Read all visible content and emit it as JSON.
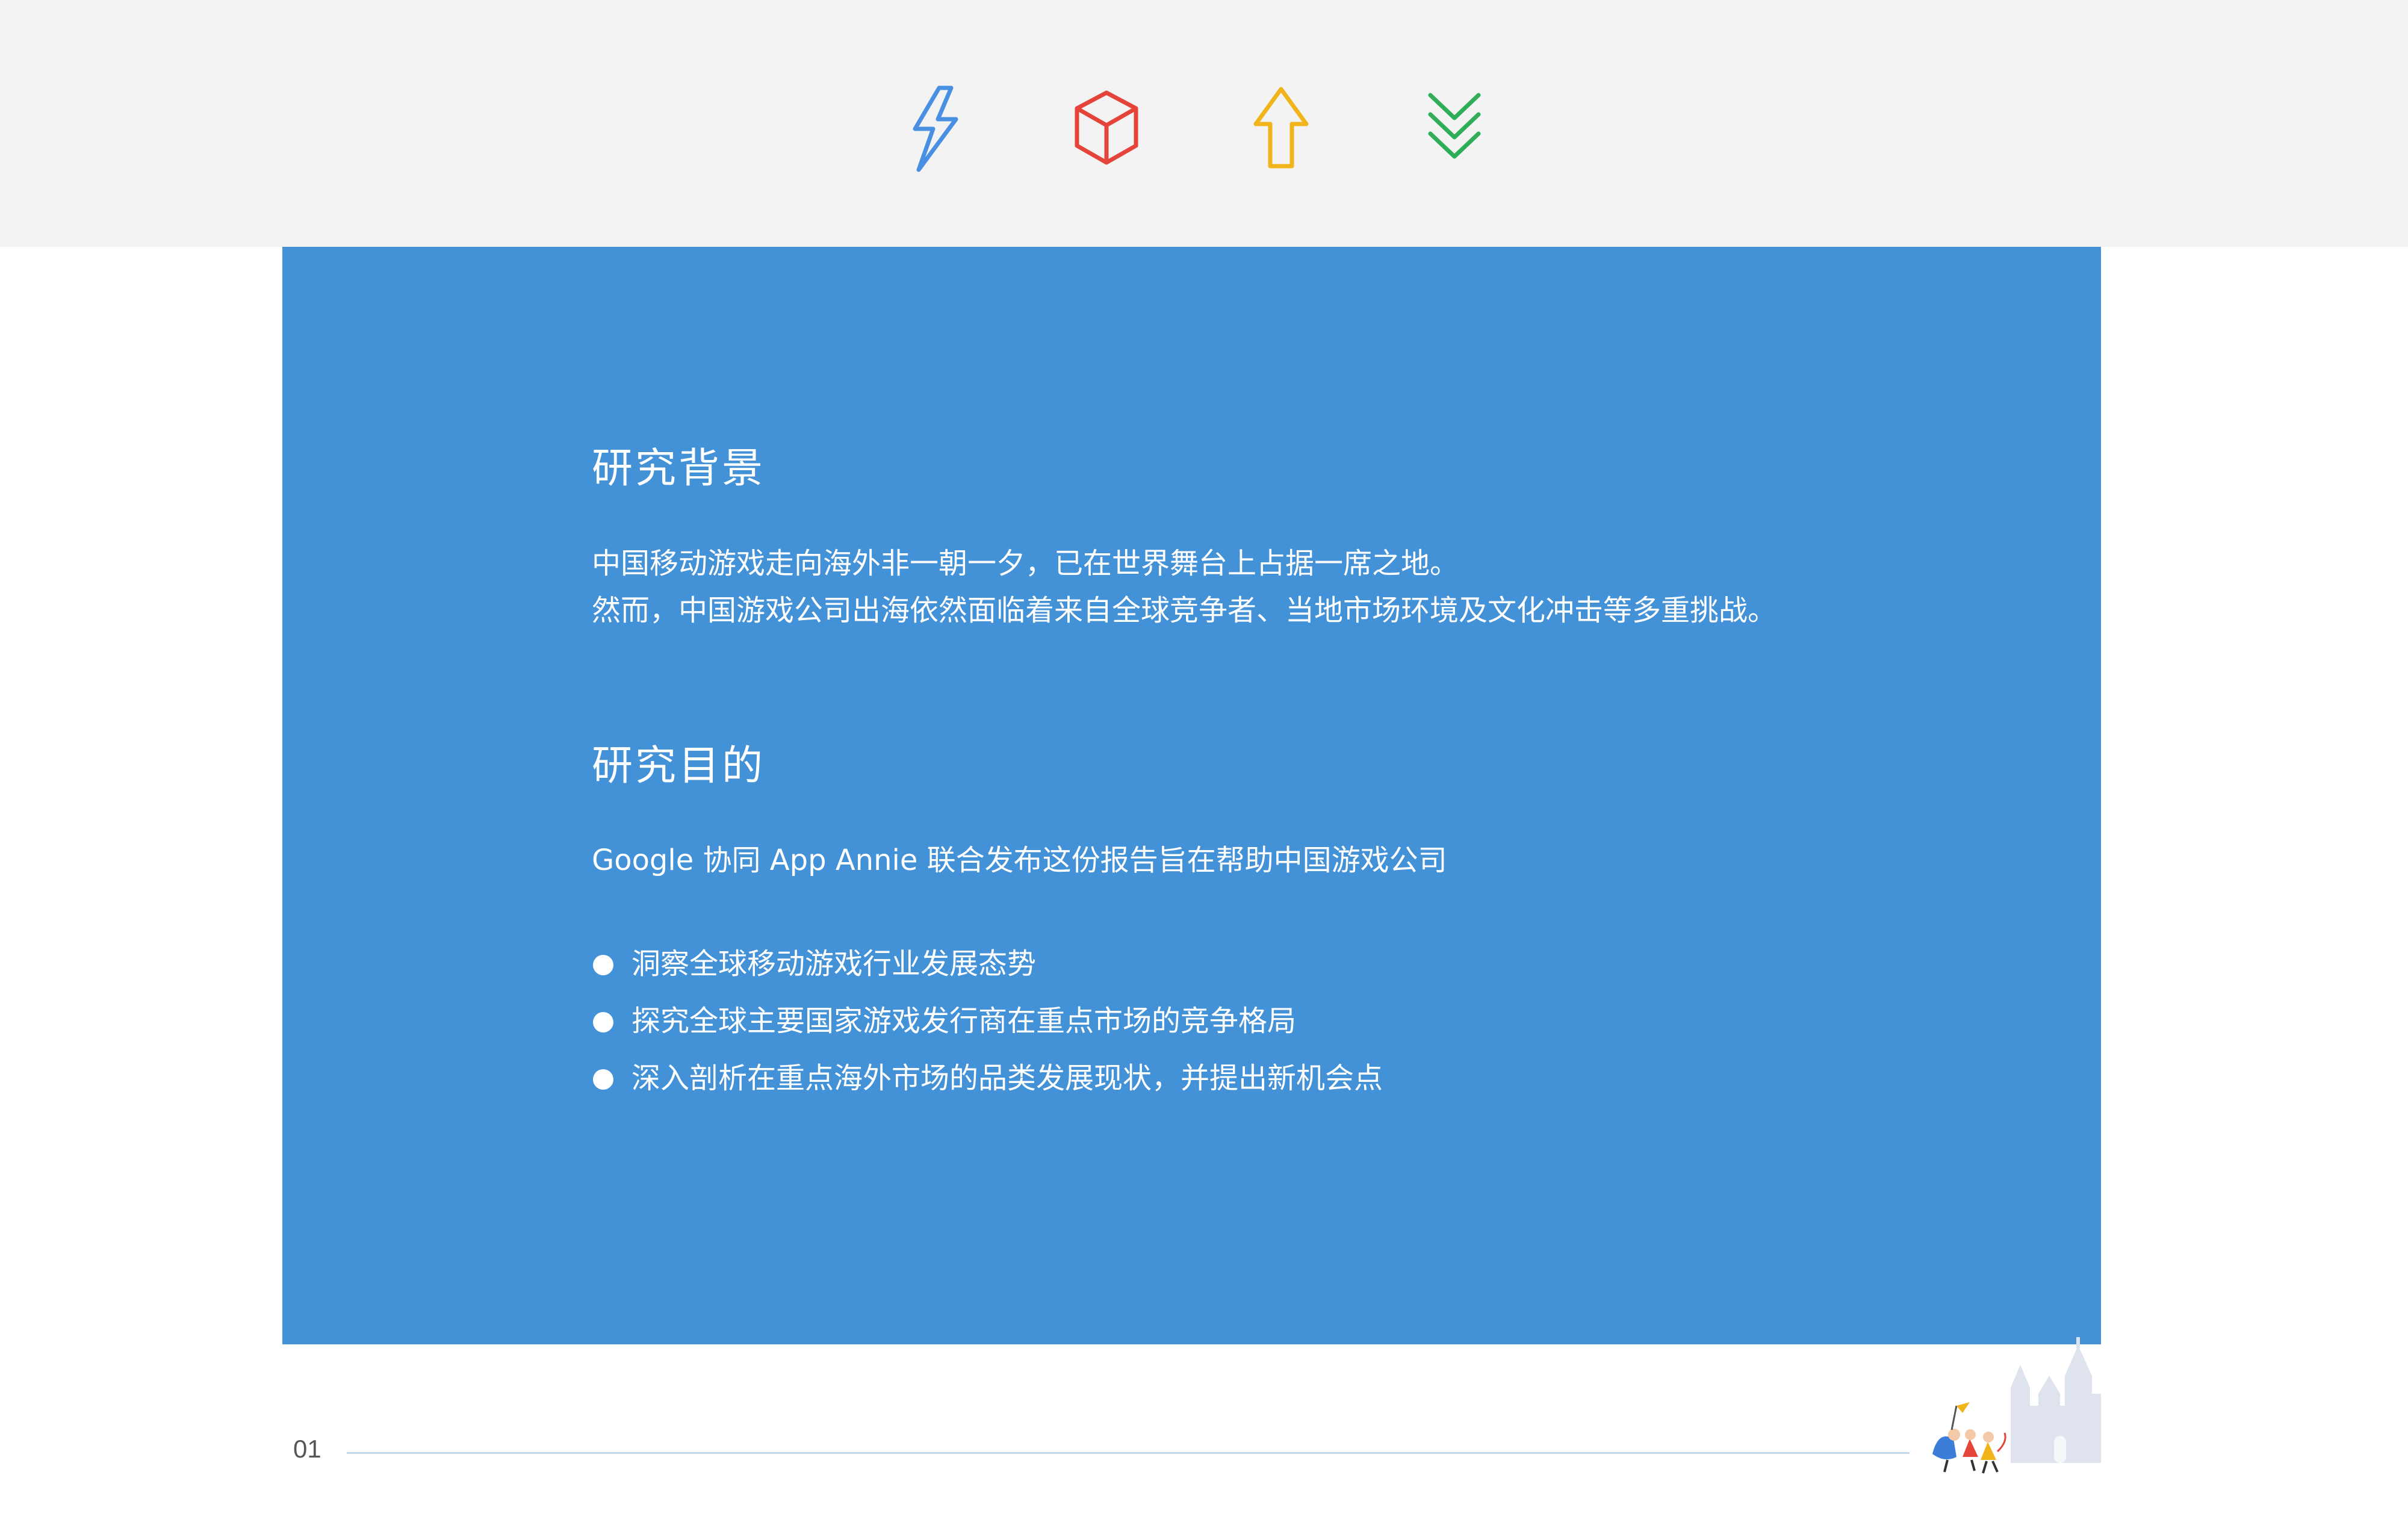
{
  "header": {
    "icons": [
      {
        "name": "lightning-icon",
        "color": "#4a90e2"
      },
      {
        "name": "cube-icon",
        "color": "#e4443a"
      },
      {
        "name": "up-arrow-icon",
        "color": "#f2b41b"
      },
      {
        "name": "double-chevron-down-icon",
        "color": "#2fae57"
      }
    ]
  },
  "background": {
    "heading": "研究背景",
    "lines": [
      "中国移动游戏走向海外非一朝一夕，已在世界舞台上占据一席之地。",
      "然而，中国游戏公司出海依然面临着来自全球竞争者、当地市场环境及文化冲击等多重挑战。"
    ]
  },
  "purpose": {
    "heading": "研究目的",
    "intro": "Google 协同 App Annie 联合发布这份报告旨在帮助中国游戏公司",
    "bullets": [
      "洞察全球移动游戏行业发展态势",
      "探究全球主要国家游戏发行商在重点市场的竞争格局",
      "深入剖析在重点海外市场的品类发展现状，并提出新机会点"
    ]
  },
  "footer": {
    "page_number": "01"
  },
  "colors": {
    "panel": "#4391d6",
    "top_band": "#f3f3f3",
    "rule": "#c7d8ea"
  }
}
